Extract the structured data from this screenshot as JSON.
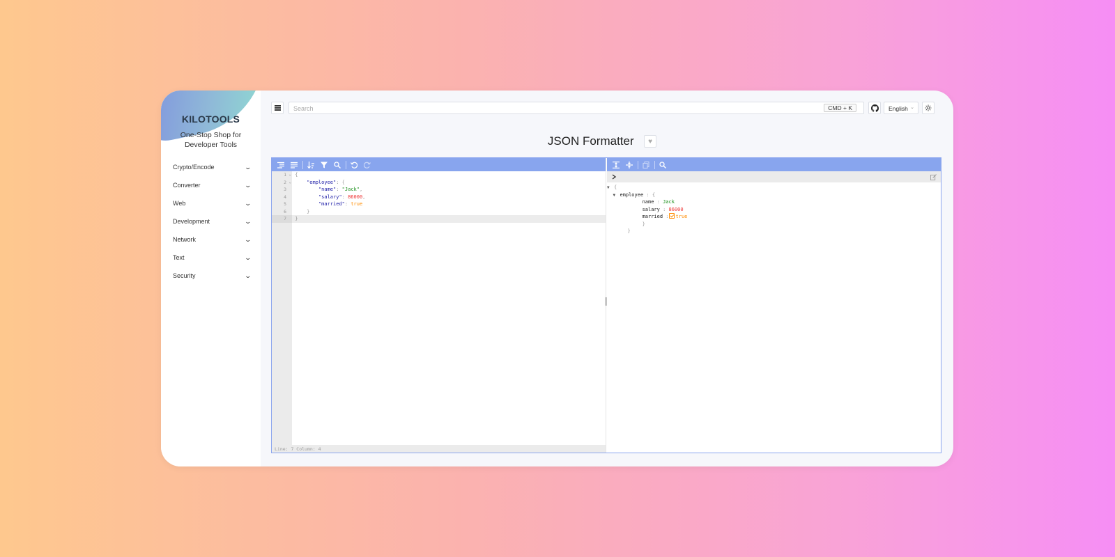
{
  "app": {
    "logo": "KILOTOOLS",
    "tagline": "One-Stop Shop for Developer Tools"
  },
  "sidebar": {
    "items": [
      {
        "label": "Crypto/Encode"
      },
      {
        "label": "Converter"
      },
      {
        "label": "Web"
      },
      {
        "label": "Development"
      },
      {
        "label": "Network"
      },
      {
        "label": "Text"
      },
      {
        "label": "Security"
      }
    ]
  },
  "topbar": {
    "search_placeholder": "Search",
    "shortcut": "CMD + K",
    "language": "English"
  },
  "page": {
    "title": "JSON Formatter"
  },
  "editor": {
    "line_numbers": [
      "1",
      "2",
      "3",
      "4",
      "5",
      "6",
      "7"
    ],
    "lines": [
      {
        "indent": "",
        "key": "",
        "colon": "",
        "value": "{",
        "vtype": "p",
        "comma": ""
      },
      {
        "indent": "    ",
        "key": "\"employee\"",
        "colon": ": ",
        "value": "{",
        "vtype": "p",
        "comma": ""
      },
      {
        "indent": "        ",
        "key": "\"name\"",
        "colon": ": ",
        "value": "\"Jack\"",
        "vtype": "s",
        "comma": ","
      },
      {
        "indent": "        ",
        "key": "\"salary\"",
        "colon": ": ",
        "value": "86000",
        "vtype": "n",
        "comma": ","
      },
      {
        "indent": "        ",
        "key": "\"married\"",
        "colon": ": ",
        "value": "true",
        "vtype": "b",
        "comma": ""
      },
      {
        "indent": "    ",
        "key": "",
        "colon": "",
        "value": "}",
        "vtype": "p",
        "comma": ""
      },
      {
        "indent": "",
        "key": "",
        "colon": "",
        "value": "}",
        "vtype": "p",
        "comma": ""
      }
    ],
    "status": "Line: 7  Column: 4"
  },
  "tree": {
    "open_brace": "{",
    "close_brace": "}",
    "root_key": "employee",
    "fields": [
      {
        "key": "name",
        "value": "Jack",
        "vtype": "s"
      },
      {
        "key": "salary",
        "value": "86000",
        "vtype": "n"
      },
      {
        "key": "married",
        "value": "true",
        "vtype": "b"
      }
    ]
  },
  "colors": {
    "toolbar": "#88a5ee",
    "accent_string": "#1a8f1a",
    "accent_number": "#ee3333",
    "accent_boolean": "#ff8c00"
  }
}
